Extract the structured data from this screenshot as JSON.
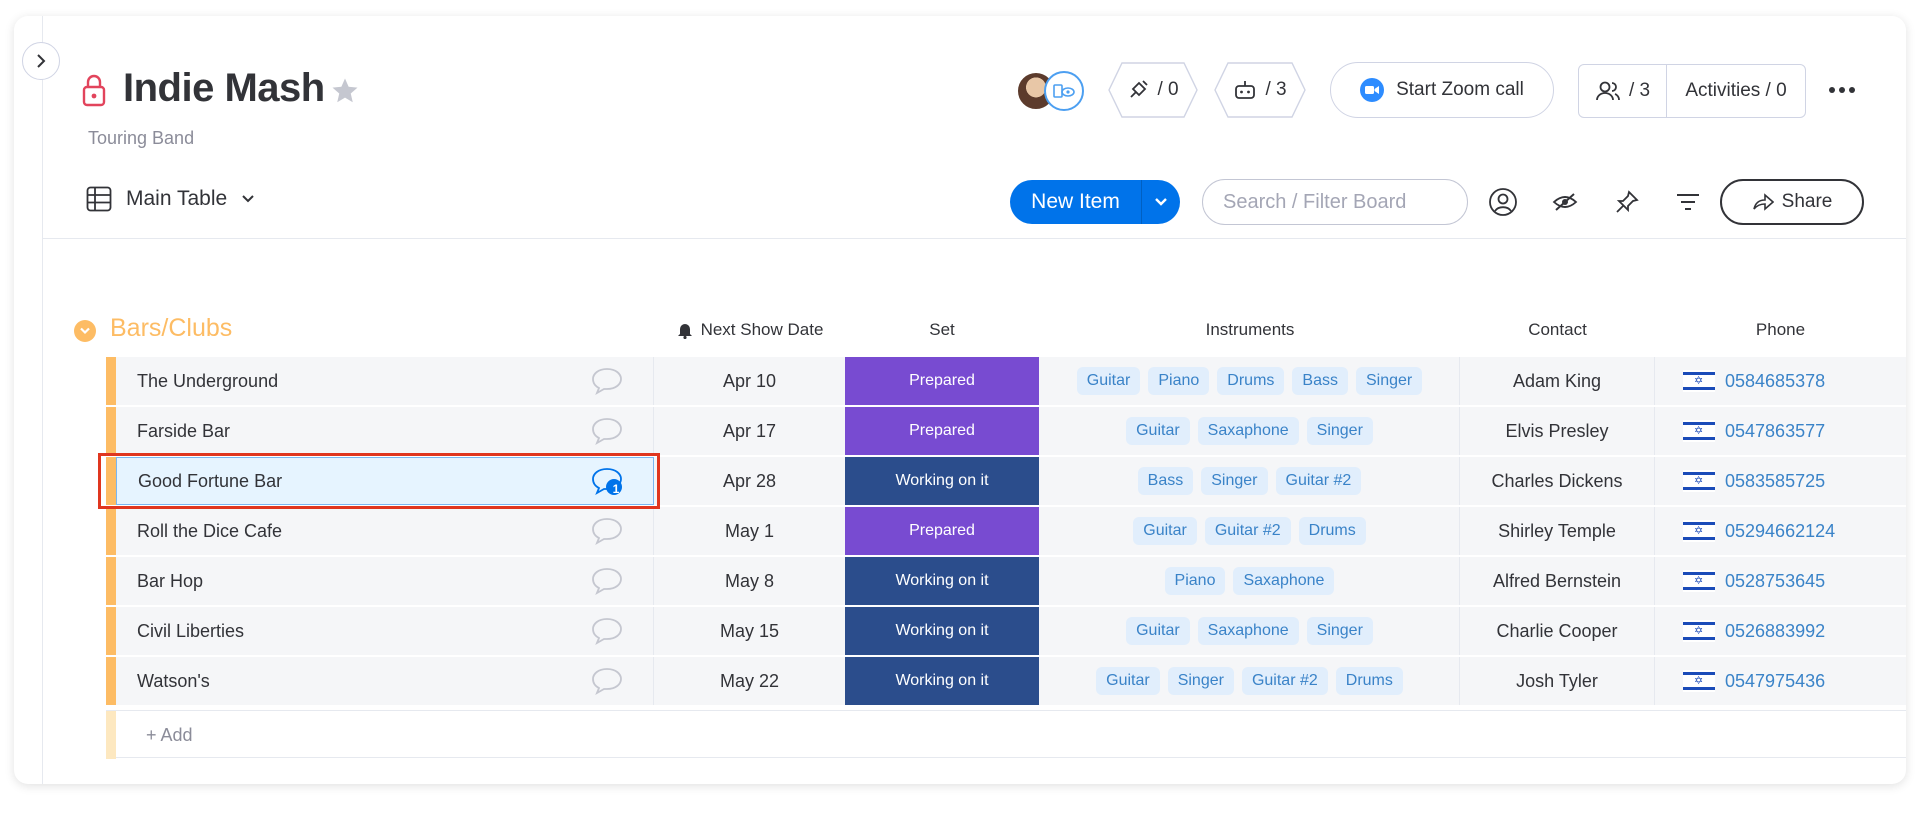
{
  "board": {
    "title": "Indie Mash",
    "subtitle": "Touring Band"
  },
  "header": {
    "integrations_count": "/ 0",
    "automations_count": "/ 3",
    "zoom_label": "Start Zoom call",
    "members_count": "/ 3",
    "activities_label": "Activities / 0"
  },
  "toolbar": {
    "view_label": "Main Table",
    "new_item_label": "New Item",
    "search_placeholder": "Search / Filter Board",
    "share_label": "Share"
  },
  "group": {
    "title": "Bars/Clubs",
    "color": "#fdbc64",
    "columns": {
      "next_show": "Next Show Date",
      "set": "Set",
      "instruments": "Instruments",
      "contact": "Contact",
      "phone": "Phone"
    },
    "rows": [
      {
        "name": "The Underground",
        "date": "Apr 10",
        "set": "Prepared",
        "instruments": [
          "Guitar",
          "Piano",
          "Drums",
          "Bass",
          "Singer"
        ],
        "contact": "Adam King",
        "phone": "0584685378",
        "comments": ""
      },
      {
        "name": "Farside Bar",
        "date": "Apr 17",
        "set": "Prepared",
        "instruments": [
          "Guitar",
          "Saxaphone",
          "Singer"
        ],
        "contact": "Elvis Presley",
        "phone": "0547863577",
        "comments": ""
      },
      {
        "name": "Good Fortune Bar",
        "date": "Apr 28",
        "set": "Working on it",
        "instruments": [
          "Bass",
          "Singer",
          "Guitar #2"
        ],
        "contact": "Charles Dickens",
        "phone": "0583585725",
        "comments": "1"
      },
      {
        "name": "Roll the Dice Cafe",
        "date": "May 1",
        "set": "Prepared",
        "instruments": [
          "Guitar",
          "Guitar #2",
          "Drums"
        ],
        "contact": "Shirley Temple",
        "phone": "05294662124",
        "comments": ""
      },
      {
        "name": "Bar Hop",
        "date": "May 8",
        "set": "Working on it",
        "instruments": [
          "Piano",
          "Saxaphone"
        ],
        "contact": "Alfred Bernstein",
        "phone": "0528753645",
        "comments": ""
      },
      {
        "name": "Civil Liberties",
        "date": "May 15",
        "set": "Working on it",
        "instruments": [
          "Guitar",
          "Saxaphone",
          "Singer"
        ],
        "contact": "Charlie Cooper",
        "phone": "0526883992",
        "comments": ""
      },
      {
        "name": "Watson's",
        "date": "May 22",
        "set": "Working on it",
        "instruments": [
          "Guitar",
          "Singer",
          "Guitar #2",
          "Drums"
        ],
        "contact": "Josh Tyler",
        "phone": "0547975436",
        "comments": ""
      }
    ],
    "add_label": "+ Add"
  },
  "status_colors": {
    "Prepared": "#784bd1",
    "Working on it": "#2b4d8c"
  },
  "icons": [
    "chevron-right-icon",
    "lock-icon",
    "star-icon",
    "integrations-icon",
    "automations-icon",
    "zoom-icon",
    "members-icon",
    "more-icon",
    "table-icon",
    "chevron-down-icon",
    "person-icon",
    "eye-off-icon",
    "pin-icon",
    "filter-icon",
    "share-icon",
    "comment-icon",
    "flag-icon"
  ]
}
